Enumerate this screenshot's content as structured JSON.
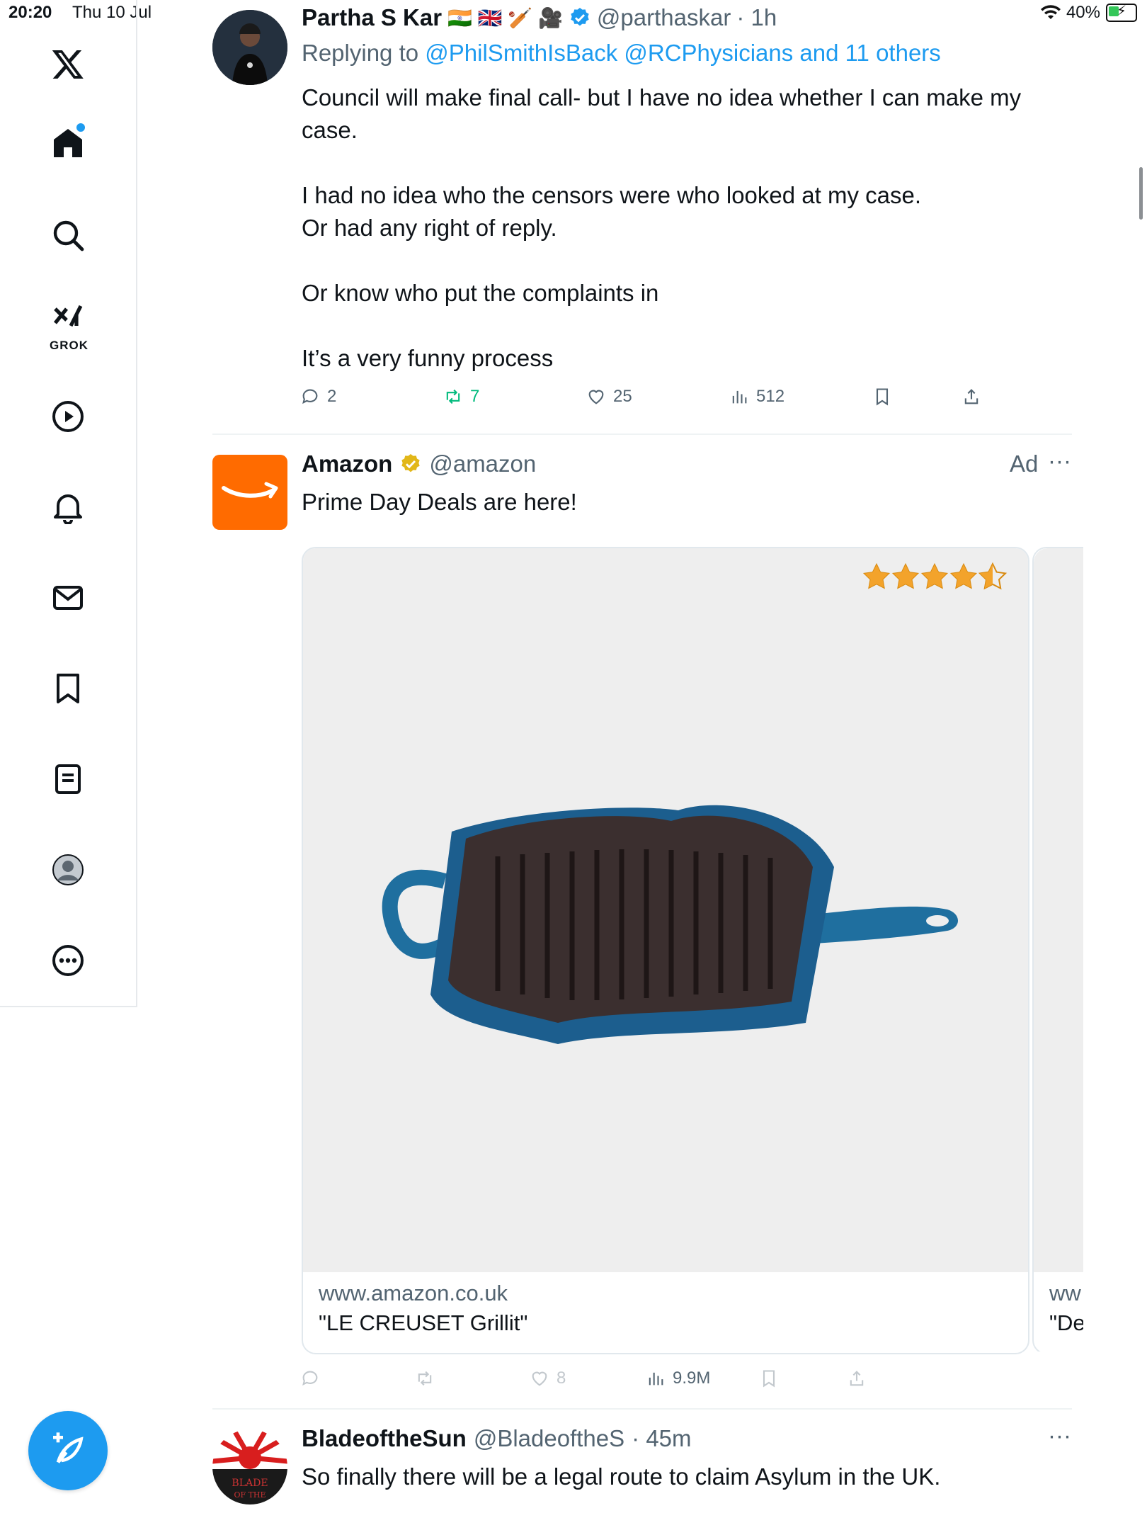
{
  "status_bar": {
    "time": "20:20",
    "date": "Thu 10 Jul",
    "battery": "40%"
  },
  "sidebar": {
    "logo": "X",
    "items": [
      "home-icon",
      "search-icon",
      "grok-icon",
      "video-icon",
      "notifications-icon",
      "messages-icon",
      "bookmarks-icon",
      "lists-icon",
      "profile-icon",
      "more-icon"
    ],
    "grok_label": "GROK",
    "compose": "compose-icon"
  },
  "tweet1": {
    "name": "Partha S Kar",
    "flags": "🇮🇳 🇬🇧 🏏 🎥",
    "handle": "@parthaskar",
    "time": "· 1h",
    "replying_prefix": "Replying to",
    "replying_to": "@PhilSmithIsBack @RCPhysicians and 11 others",
    "text_l1": "Council will make final call- but I have no idea whether I can make my",
    "text_l2": "case.",
    "text_l3": "I had no idea who the censors were who looked at my case.",
    "text_l4": "Or had any right of reply.",
    "text_l5": "Or know who put the complaints in",
    "text_l6": "It’s a very funny process",
    "replies": "2",
    "reposts": "7",
    "likes": "25",
    "views": "512"
  },
  "tweet2": {
    "name": "Amazon",
    "handle": "@amazon",
    "ad_label": "Ad",
    "more": "···",
    "text": "Prime Day Deals are here!",
    "card1_domain": "www.amazon.co.uk",
    "card1_title": "\"LE CREUSET Grillit\"",
    "card2_domain": "ww",
    "card2_title": "\"De",
    "rating_stars": 4.5,
    "likes": "8",
    "views": "9.9M"
  },
  "tweet3": {
    "name": "BladeoftheSun",
    "handle": "@BladeoftheS",
    "time": "· 45m",
    "more": "···",
    "text": "So finally there will be a legal route to claim Asylum in the UK.",
    "avatar_text_1": "BLADE",
    "avatar_text_2": "OF THE"
  },
  "colors": {
    "accent": "#1d9bf0",
    "repost_green": "#00ba7c",
    "amazon_orange": "#ff6b00",
    "star": "#f3a32b"
  }
}
